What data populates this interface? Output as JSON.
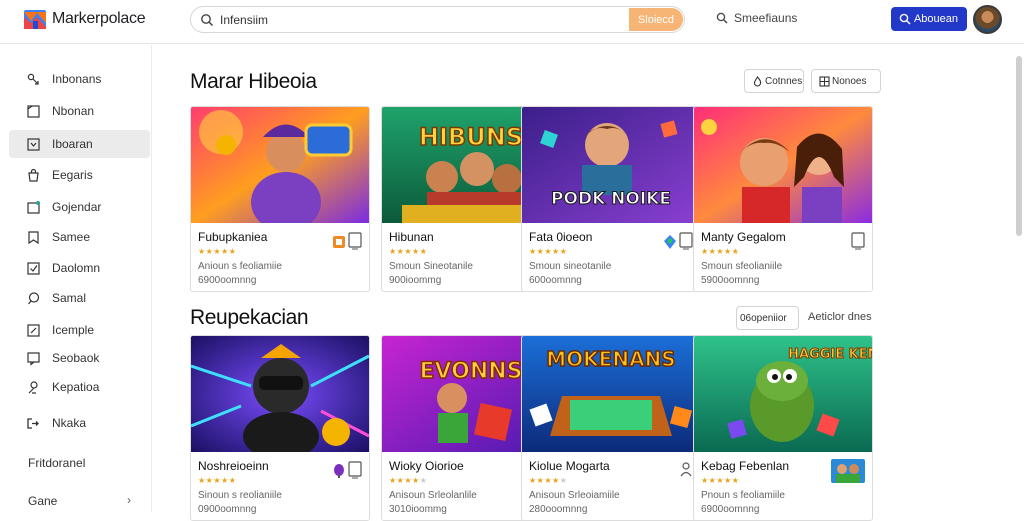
{
  "app": {
    "title": "Markerpolace"
  },
  "search": {
    "value": "Infensiim",
    "button_label": "Sloiecd"
  },
  "header": {
    "link_label": "Smeefiauns",
    "account_label": "Abouean"
  },
  "sidebar": {
    "items": [
      {
        "label": "Inbonans",
        "icon": "link-icon"
      },
      {
        "label": "Nbonan",
        "icon": "square-icon"
      },
      {
        "label": "Iboaran",
        "icon": "inbox-icon",
        "active": true
      },
      {
        "label": "Eegaris",
        "icon": "bag-icon"
      },
      {
        "label": "Gojendar",
        "icon": "calendar-icon"
      },
      {
        "label": "Samee",
        "icon": "bookmark-icon"
      },
      {
        "label": "Daolomn",
        "icon": "checkbox-icon"
      },
      {
        "label": "Samal",
        "icon": "chat-icon"
      },
      {
        "label": "Icemple",
        "icon": "edit-icon"
      },
      {
        "label": "Seobaok",
        "icon": "feedback-icon"
      },
      {
        "label": "Kepatioa",
        "icon": "user-icon"
      },
      {
        "label": "Nkaka",
        "icon": "exit-icon"
      }
    ],
    "section_label": "Fritdoranel",
    "footer_label": "Gane"
  },
  "sections": [
    {
      "title": "Marar Hibeoia",
      "buttons": [
        {
          "label": "Cotnnes",
          "icon": "fire-icon"
        },
        {
          "label": "Nonoes",
          "icon": "grid-icon"
        }
      ],
      "cards": [
        {
          "title": "Fubupkaniea",
          "stars": 5,
          "line1": "Anioun s feoliamiie",
          "line2": "6900oomnng",
          "icon": "badge-icon",
          "theme": "carnival"
        },
        {
          "title": "Hibunan",
          "stars": 5,
          "line1": "Smoun Sineotanile",
          "line2": "900ioommg",
          "icon": "more-icon",
          "theme": "hibuns"
        },
        {
          "title": "Fata 0ioeon",
          "stars": 5,
          "line1": "Smoun sineotanile",
          "line2": "600oomnng",
          "icon": "tag-icon",
          "theme": "podk"
        },
        {
          "title": "Manty Gegalom",
          "stars": 5,
          "line1": "Smoun sfeolianiile",
          "line2": "5900oomnng",
          "icon": "none",
          "theme": "duo"
        }
      ],
      "banner_text": [
        "HIBUNS",
        "PODK NOIKE"
      ]
    },
    {
      "title": "Reupekacian",
      "links": [
        "06openiior",
        "Aeticlor dnes"
      ],
      "cards": [
        {
          "title": "Noshreioeinn",
          "stars": 5,
          "line1": "Sinoun s reolianiile",
          "line2": "0900oomnng",
          "icon": "gem-icon",
          "theme": "vr"
        },
        {
          "title": "Wioky Oiorioe",
          "stars": 4,
          "line1": "Anisoun Srleolanlile",
          "line2": "3010ioommg",
          "icon": "more-icon",
          "theme": "evonns"
        },
        {
          "title": "Kiolue Mogarta",
          "stars": 4,
          "line1": "Anisoun Srleoiamiile",
          "line2": "280ooomnng",
          "icon": "people-icon",
          "theme": "moken"
        },
        {
          "title": "Kebag Febenlan",
          "stars": 5,
          "line1": "Pnoun s feoliamiile",
          "line2": "6900oomnng",
          "icon": "thumb-icon",
          "theme": "dino"
        }
      ],
      "banner_text": [
        "EVONNS",
        "MOKENANS",
        "HAGGIE KEMS"
      ]
    }
  ],
  "colors": {
    "accent": "#2238c8",
    "search_button": "#f6b574",
    "active_nav": "#ebebeb",
    "star": "#e8a21b"
  }
}
